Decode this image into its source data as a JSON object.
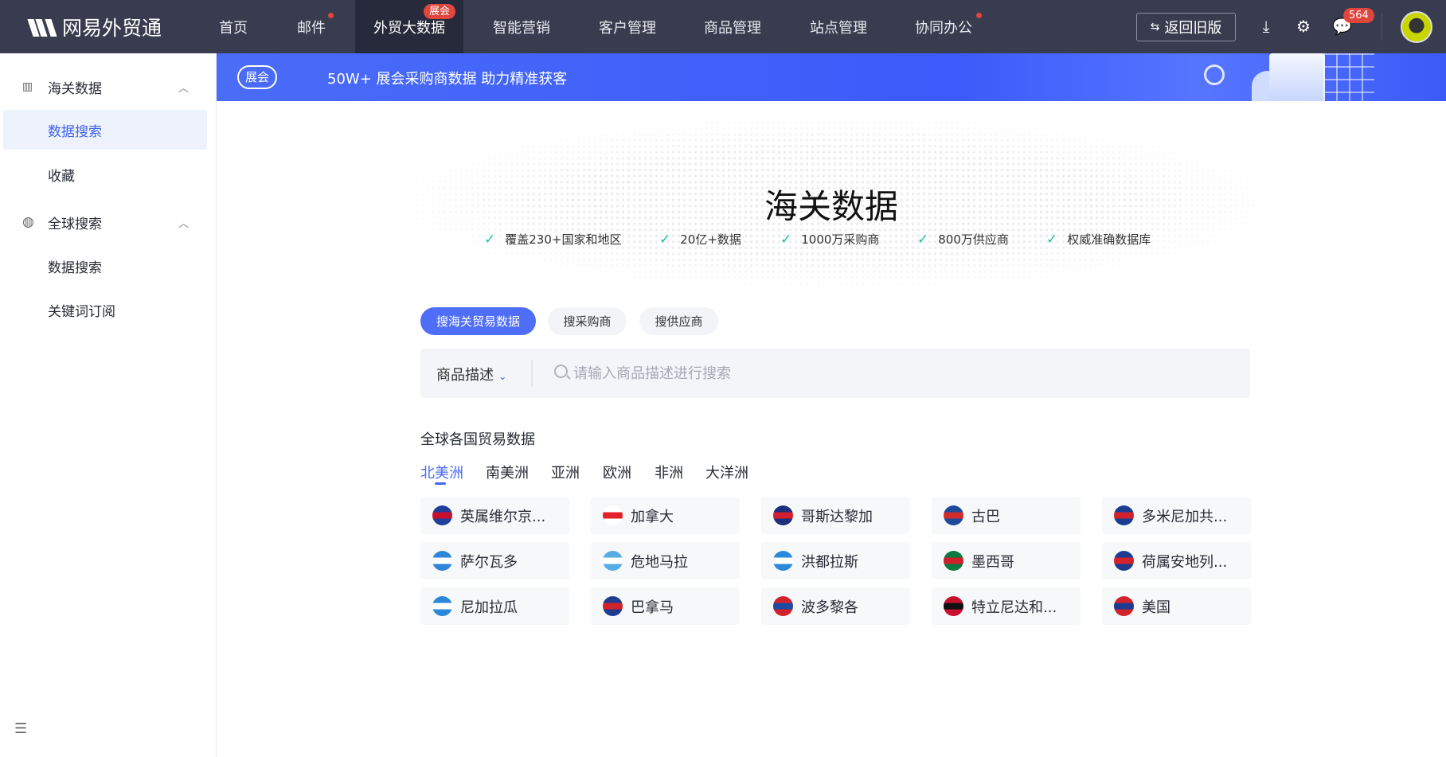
{
  "topbar": {
    "brand": "网易外贸通",
    "nav": [
      {
        "label": "首页"
      },
      {
        "label": "邮件",
        "dot": true
      },
      {
        "label": "外贸大数据",
        "badge": "展会",
        "active": true
      },
      {
        "label": "智能营销"
      },
      {
        "label": "客户管理"
      },
      {
        "label": "商品管理"
      },
      {
        "label": "站点管理"
      },
      {
        "label": "协同办公",
        "dot": true
      }
    ],
    "back_old": "返回旧版",
    "message_count": "564"
  },
  "sidebar": {
    "groups": [
      {
        "label": "海关数据",
        "items": [
          "数据搜索",
          "收藏"
        ]
      },
      {
        "label": "全球搜索",
        "items": [
          "数据搜索",
          "关键词订阅"
        ]
      }
    ]
  },
  "banner": {
    "pill": "展会",
    "text": "50W+ 展会采购商数据 助力精准获客"
  },
  "hero": {
    "title": "海关数据",
    "features": [
      "覆盖230+国家和地区",
      "20亿+数据",
      "1000万采购商",
      "800万供应商",
      "权威准确数据库"
    ]
  },
  "search": {
    "tabs": [
      "搜海关贸易数据",
      "搜采购商",
      "搜供应商"
    ],
    "field": "商品描述",
    "placeholder": "请输入商品描述进行搜索"
  },
  "countries": {
    "heading": "全球各国贸易数据",
    "regions": [
      "北美洲",
      "南美洲",
      "亚洲",
      "欧洲",
      "非洲",
      "大洋洲"
    ],
    "active_region": "北美洲",
    "items": [
      {
        "name": "英属维尔京...",
        "colors": [
          "#1f3f9a",
          "#c8102e"
        ]
      },
      {
        "name": "加拿大",
        "colors": [
          "#fff",
          "#e4202c"
        ]
      },
      {
        "name": "哥斯达黎加",
        "colors": [
          "#1c2f7a",
          "#d1202f"
        ]
      },
      {
        "name": "古巴",
        "colors": [
          "#1f4a9c",
          "#d22c2c"
        ]
      },
      {
        "name": "多米尼加共...",
        "colors": [
          "#1a3d8f",
          "#d2232c"
        ]
      },
      {
        "name": "萨尔瓦多",
        "colors": [
          "#2f86d8",
          "#fff"
        ]
      },
      {
        "name": "危地马拉",
        "colors": [
          "#55aee3",
          "#fff"
        ]
      },
      {
        "name": "洪都拉斯",
        "colors": [
          "#2a8ad8",
          "#fff"
        ]
      },
      {
        "name": "墨西哥",
        "colors": [
          "#0d7a42",
          "#d0202c"
        ]
      },
      {
        "name": "荷属安地列...",
        "colors": [
          "#1e3c8f",
          "#d2232c"
        ]
      },
      {
        "name": "尼加拉瓜",
        "colors": [
          "#2b87d8",
          "#fff"
        ]
      },
      {
        "name": "巴拿马",
        "colors": [
          "#1e3c8f",
          "#d2232c"
        ]
      },
      {
        "name": "波多黎各",
        "colors": [
          "#d2232c",
          "#1e4aa0"
        ]
      },
      {
        "name": "特立尼达和...",
        "colors": [
          "#c8102e",
          "#111"
        ]
      },
      {
        "name": "美国",
        "colors": [
          "#d2232c",
          "#1e3c8f"
        ]
      }
    ]
  }
}
